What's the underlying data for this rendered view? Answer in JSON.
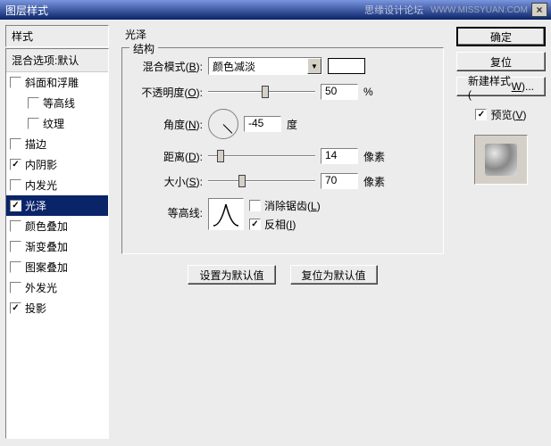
{
  "titlebar": {
    "title": "图层样式",
    "watermark": "思缘设计论坛",
    "url": "WWW.MISSYUAN.COM",
    "close": "×"
  },
  "left": {
    "header": "样式",
    "blend": "混合选项:默认",
    "items": [
      {
        "label": "斜面和浮雕",
        "checked": false
      },
      {
        "label": "等高线",
        "checked": false,
        "indent": true
      },
      {
        "label": "纹理",
        "checked": false,
        "indent": true
      },
      {
        "label": "描边",
        "checked": false
      },
      {
        "label": "内阴影",
        "checked": true
      },
      {
        "label": "内发光",
        "checked": false
      },
      {
        "label": "光泽",
        "checked": true,
        "selected": true
      },
      {
        "label": "颜色叠加",
        "checked": false
      },
      {
        "label": "渐变叠加",
        "checked": false
      },
      {
        "label": "图案叠加",
        "checked": false
      },
      {
        "label": "外发光",
        "checked": false
      },
      {
        "label": "投影",
        "checked": true
      }
    ]
  },
  "center": {
    "title": "光泽",
    "group": "结构",
    "blend_mode_label": "混合模式(B):",
    "blend_mode_value": "颜色减淡",
    "opacity_label": "不透明度(O):",
    "opacity_value": "50",
    "opacity_unit": "%",
    "angle_label": "角度(N):",
    "angle_value": "-45",
    "angle_unit": "度",
    "distance_label": "距离(D):",
    "distance_value": "14",
    "distance_unit": "像素",
    "size_label": "大小(S):",
    "size_value": "70",
    "size_unit": "像素",
    "contour_label": "等高线:",
    "antialias_label": "消除锯齿(L)",
    "invert_label": "反相(I)",
    "set_default": "设置为默认值",
    "reset_default": "复位为默认值"
  },
  "right": {
    "ok": "确定",
    "cancel": "复位",
    "new_style": "新建样式(W)...",
    "preview": "预览(V)"
  }
}
